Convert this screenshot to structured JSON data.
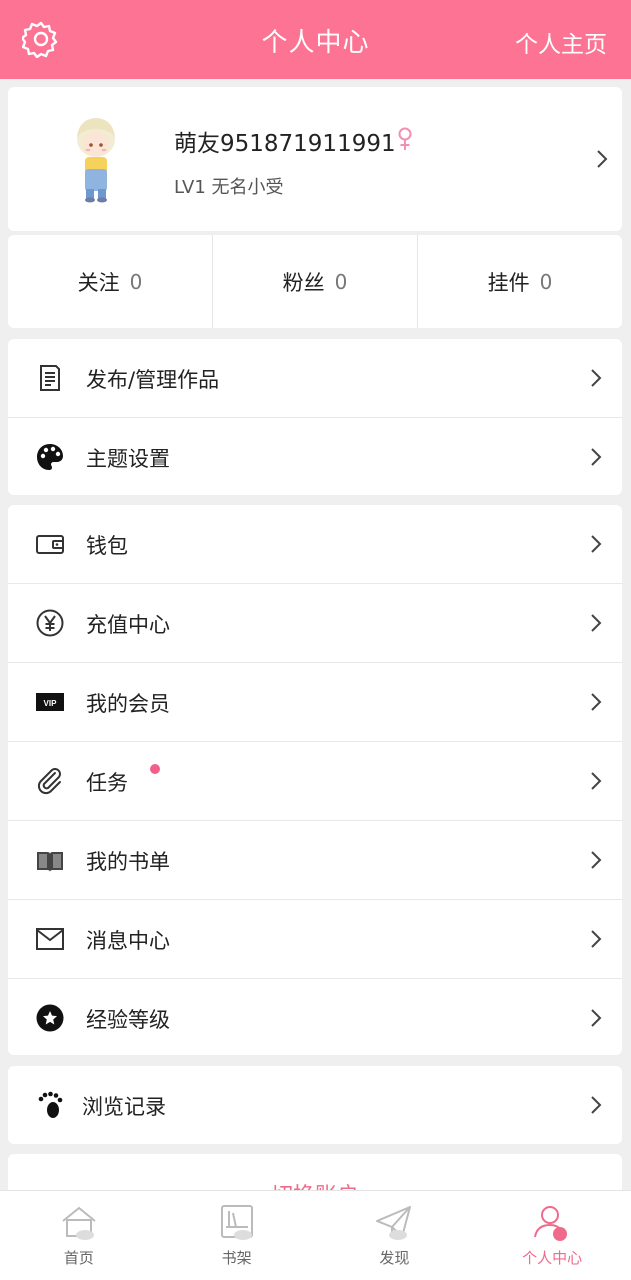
{
  "header": {
    "title": "个人中心",
    "home_link": "个人主页"
  },
  "profile": {
    "nickname": "萌友951871911991",
    "level": "LV1 无名小受"
  },
  "stats": [
    {
      "label": "关注",
      "count": "0"
    },
    {
      "label": "粉丝",
      "count": "0"
    },
    {
      "label": "挂件",
      "count": "0"
    }
  ],
  "menu_group1": [
    {
      "label": "发布/管理作品",
      "icon": "document-icon"
    },
    {
      "label": "主题设置",
      "icon": "palette-icon"
    }
  ],
  "menu_group2": [
    {
      "label": "钱包",
      "icon": "wallet-icon"
    },
    {
      "label": "充值中心",
      "icon": "yen-icon"
    },
    {
      "label": "我的会员",
      "icon": "vip-icon",
      "badge_text": "VIP"
    },
    {
      "label": "任务",
      "icon": "paperclip-icon",
      "has_dot": true
    },
    {
      "label": "我的书单",
      "icon": "book-icon"
    },
    {
      "label": "消息中心",
      "icon": "mail-icon"
    },
    {
      "label": "经验等级",
      "icon": "star-icon"
    }
  ],
  "menu_group3": [
    {
      "label": "浏览记录",
      "icon": "footprint-icon"
    }
  ],
  "switch_account": "切换账户",
  "tabbar": [
    {
      "label": "首页",
      "icon": "home-icon",
      "active": false
    },
    {
      "label": "书架",
      "icon": "bookshelf-icon",
      "active": false
    },
    {
      "label": "发现",
      "icon": "paper-plane-icon",
      "active": false
    },
    {
      "label": "个人中心",
      "icon": "person-icon",
      "active": true
    }
  ],
  "colors": {
    "accent": "#fd7394",
    "active_tab": "#f06a8c",
    "background": "#efefef",
    "dot": "#f0608a"
  }
}
